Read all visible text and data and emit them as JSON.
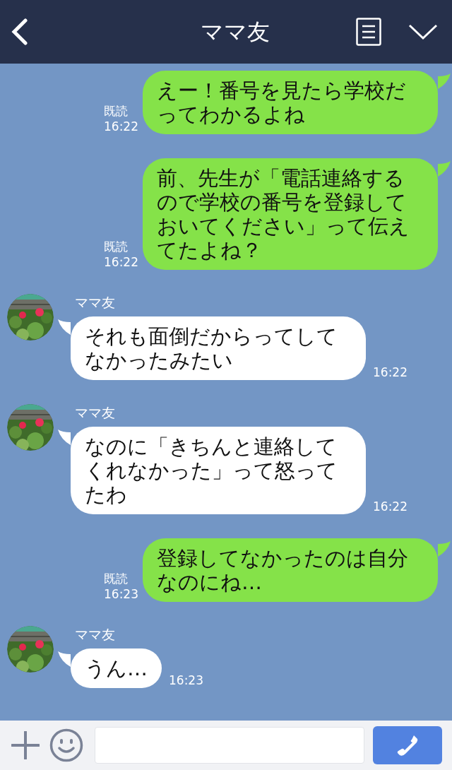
{
  "header": {
    "title": "ママ友"
  },
  "messages": [
    {
      "kind": "sent",
      "text": "えー！番号を見たら学校だってわかるよね",
      "read": "既読",
      "time": "16:22"
    },
    {
      "kind": "sent",
      "text": "前、先生が「電話連絡するので学校の番号を登録しておいてください」って伝えてたよね？",
      "read": "既読",
      "time": "16:22"
    },
    {
      "kind": "received",
      "name": "ママ友",
      "text": "それも面倒だからってしてなかったみたい",
      "time": "16:22"
    },
    {
      "kind": "received",
      "name": "ママ友",
      "text": "なのに「きちんと連絡してくれなかった」って怒ってたわ",
      "time": "16:22"
    },
    {
      "kind": "sent",
      "text": "登録してなかったのは自分なのにね…",
      "read": "既読",
      "time": "16:23"
    },
    {
      "kind": "received",
      "name": "ママ友",
      "text": "うん…",
      "time": "16:23"
    }
  ]
}
